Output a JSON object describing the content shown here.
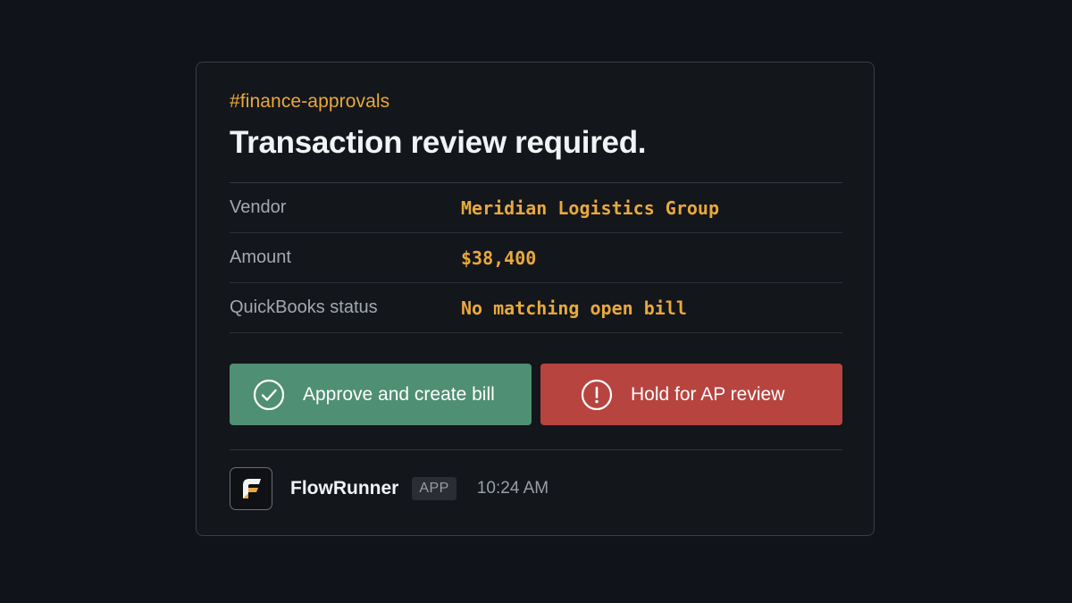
{
  "message": {
    "channel": "#finance-approvals",
    "title": "Transaction review required."
  },
  "details": [
    {
      "label": "Vendor",
      "value": "Meridian Logistics Group"
    },
    {
      "label": "Amount",
      "value": "$38,400"
    },
    {
      "label": "QuickBooks status",
      "value": "No matching open bill"
    }
  ],
  "actions": {
    "approve_label": "Approve and create bill",
    "approve_icon": "check-circle-icon",
    "hold_label": "Hold for AP review",
    "hold_icon": "exclamation-circle-icon"
  },
  "footer": {
    "app_name": "FlowRunner",
    "badge": "APP",
    "timestamp": "10:24 AM",
    "logo_icon": "flowrunner-logo-icon"
  },
  "colors": {
    "accent": "#e9a93c",
    "approve": "#4f8f73",
    "hold": "#b8443f",
    "background": "#10131a",
    "card": "#13161b"
  }
}
